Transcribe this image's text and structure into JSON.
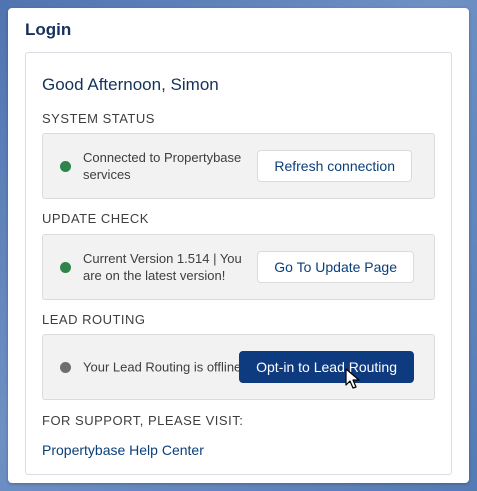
{
  "card": {
    "title": "Login"
  },
  "greeting": "Good Afternoon, Simon",
  "sections": {
    "system_status": {
      "label": "SYSTEM STATUS",
      "status_text": "Connected to Propertybase services",
      "dot_color": "#2e844a",
      "button_label": "Refresh connection"
    },
    "update_check": {
      "label": "UPDATE CHECK",
      "status_text": "Current Version 1.514 | You are on the latest version!",
      "dot_color": "#2e844a",
      "button_label": "Go To Update Page"
    },
    "lead_routing": {
      "label": "LEAD ROUTING",
      "status_text": "Your Lead Routing is offline",
      "dot_color": "#706e6b",
      "button_label": "Opt-in to Lead Routing"
    }
  },
  "support": {
    "label": "FOR SUPPORT, PLEASE VISIT:",
    "link_text": "Propertybase Help Center"
  },
  "colors": {
    "brand": "#0e3b80",
    "link": "#0b3f7a",
    "background": "#5b7fb7"
  }
}
